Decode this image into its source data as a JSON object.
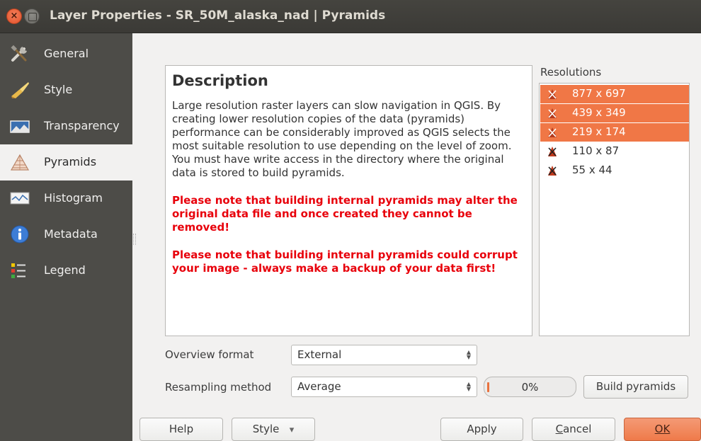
{
  "window": {
    "title": "Layer Properties - SR_50M_alaska_nad | Pyramids",
    "close_glyph": "×"
  },
  "sidebar": {
    "items": [
      {
        "label": "General",
        "icon": "general-tools-icon"
      },
      {
        "label": "Style",
        "icon": "style-brush-icon"
      },
      {
        "label": "Transparency",
        "icon": "transparency-icon"
      },
      {
        "label": "Pyramids",
        "icon": "pyramids-icon",
        "active": true
      },
      {
        "label": "Histogram",
        "icon": "histogram-icon"
      },
      {
        "label": "Metadata",
        "icon": "metadata-info-icon"
      },
      {
        "label": "Legend",
        "icon": "legend-icon"
      }
    ]
  },
  "description": {
    "title": "Description",
    "body": "Large resolution raster layers can slow navigation in QGIS. By creating lower resolution copies of the data (pyramids) performance can be considerably improved as QGIS selects the most suitable resolution to use depending on the level of zoom. You must have write access in the directory where the original data is stored to build pyramids.",
    "warning1": "Please note that building internal pyramids may alter the original data file and once created they cannot be removed!",
    "warning2": "Please note that building internal pyramids could corrupt your image - always make a backup of your data first!"
  },
  "resolutions": {
    "label": "Resolutions",
    "items": [
      {
        "text": "877 x 697",
        "selected": true
      },
      {
        "text": "439 x 349",
        "selected": true
      },
      {
        "text": "219 x 174",
        "selected": true
      },
      {
        "text": "110 x 87",
        "selected": false
      },
      {
        "text": "55 x 44",
        "selected": false
      }
    ]
  },
  "overview_format": {
    "label": "Overview format",
    "value": "External"
  },
  "resampling": {
    "label": "Resampling method",
    "value": "Average"
  },
  "progress": {
    "text": "0%",
    "value": 0
  },
  "buttons": {
    "build": "Build pyramids",
    "help": "Help",
    "style": "Style",
    "style_arrow": "▾",
    "apply": "Apply",
    "cancel_prefix": "C",
    "cancel_rest": "ancel",
    "ok": "OK"
  },
  "colors": {
    "accent": "#f07746",
    "warning_text": "#e8000b",
    "sidebar_bg": "#4d4c48"
  }
}
